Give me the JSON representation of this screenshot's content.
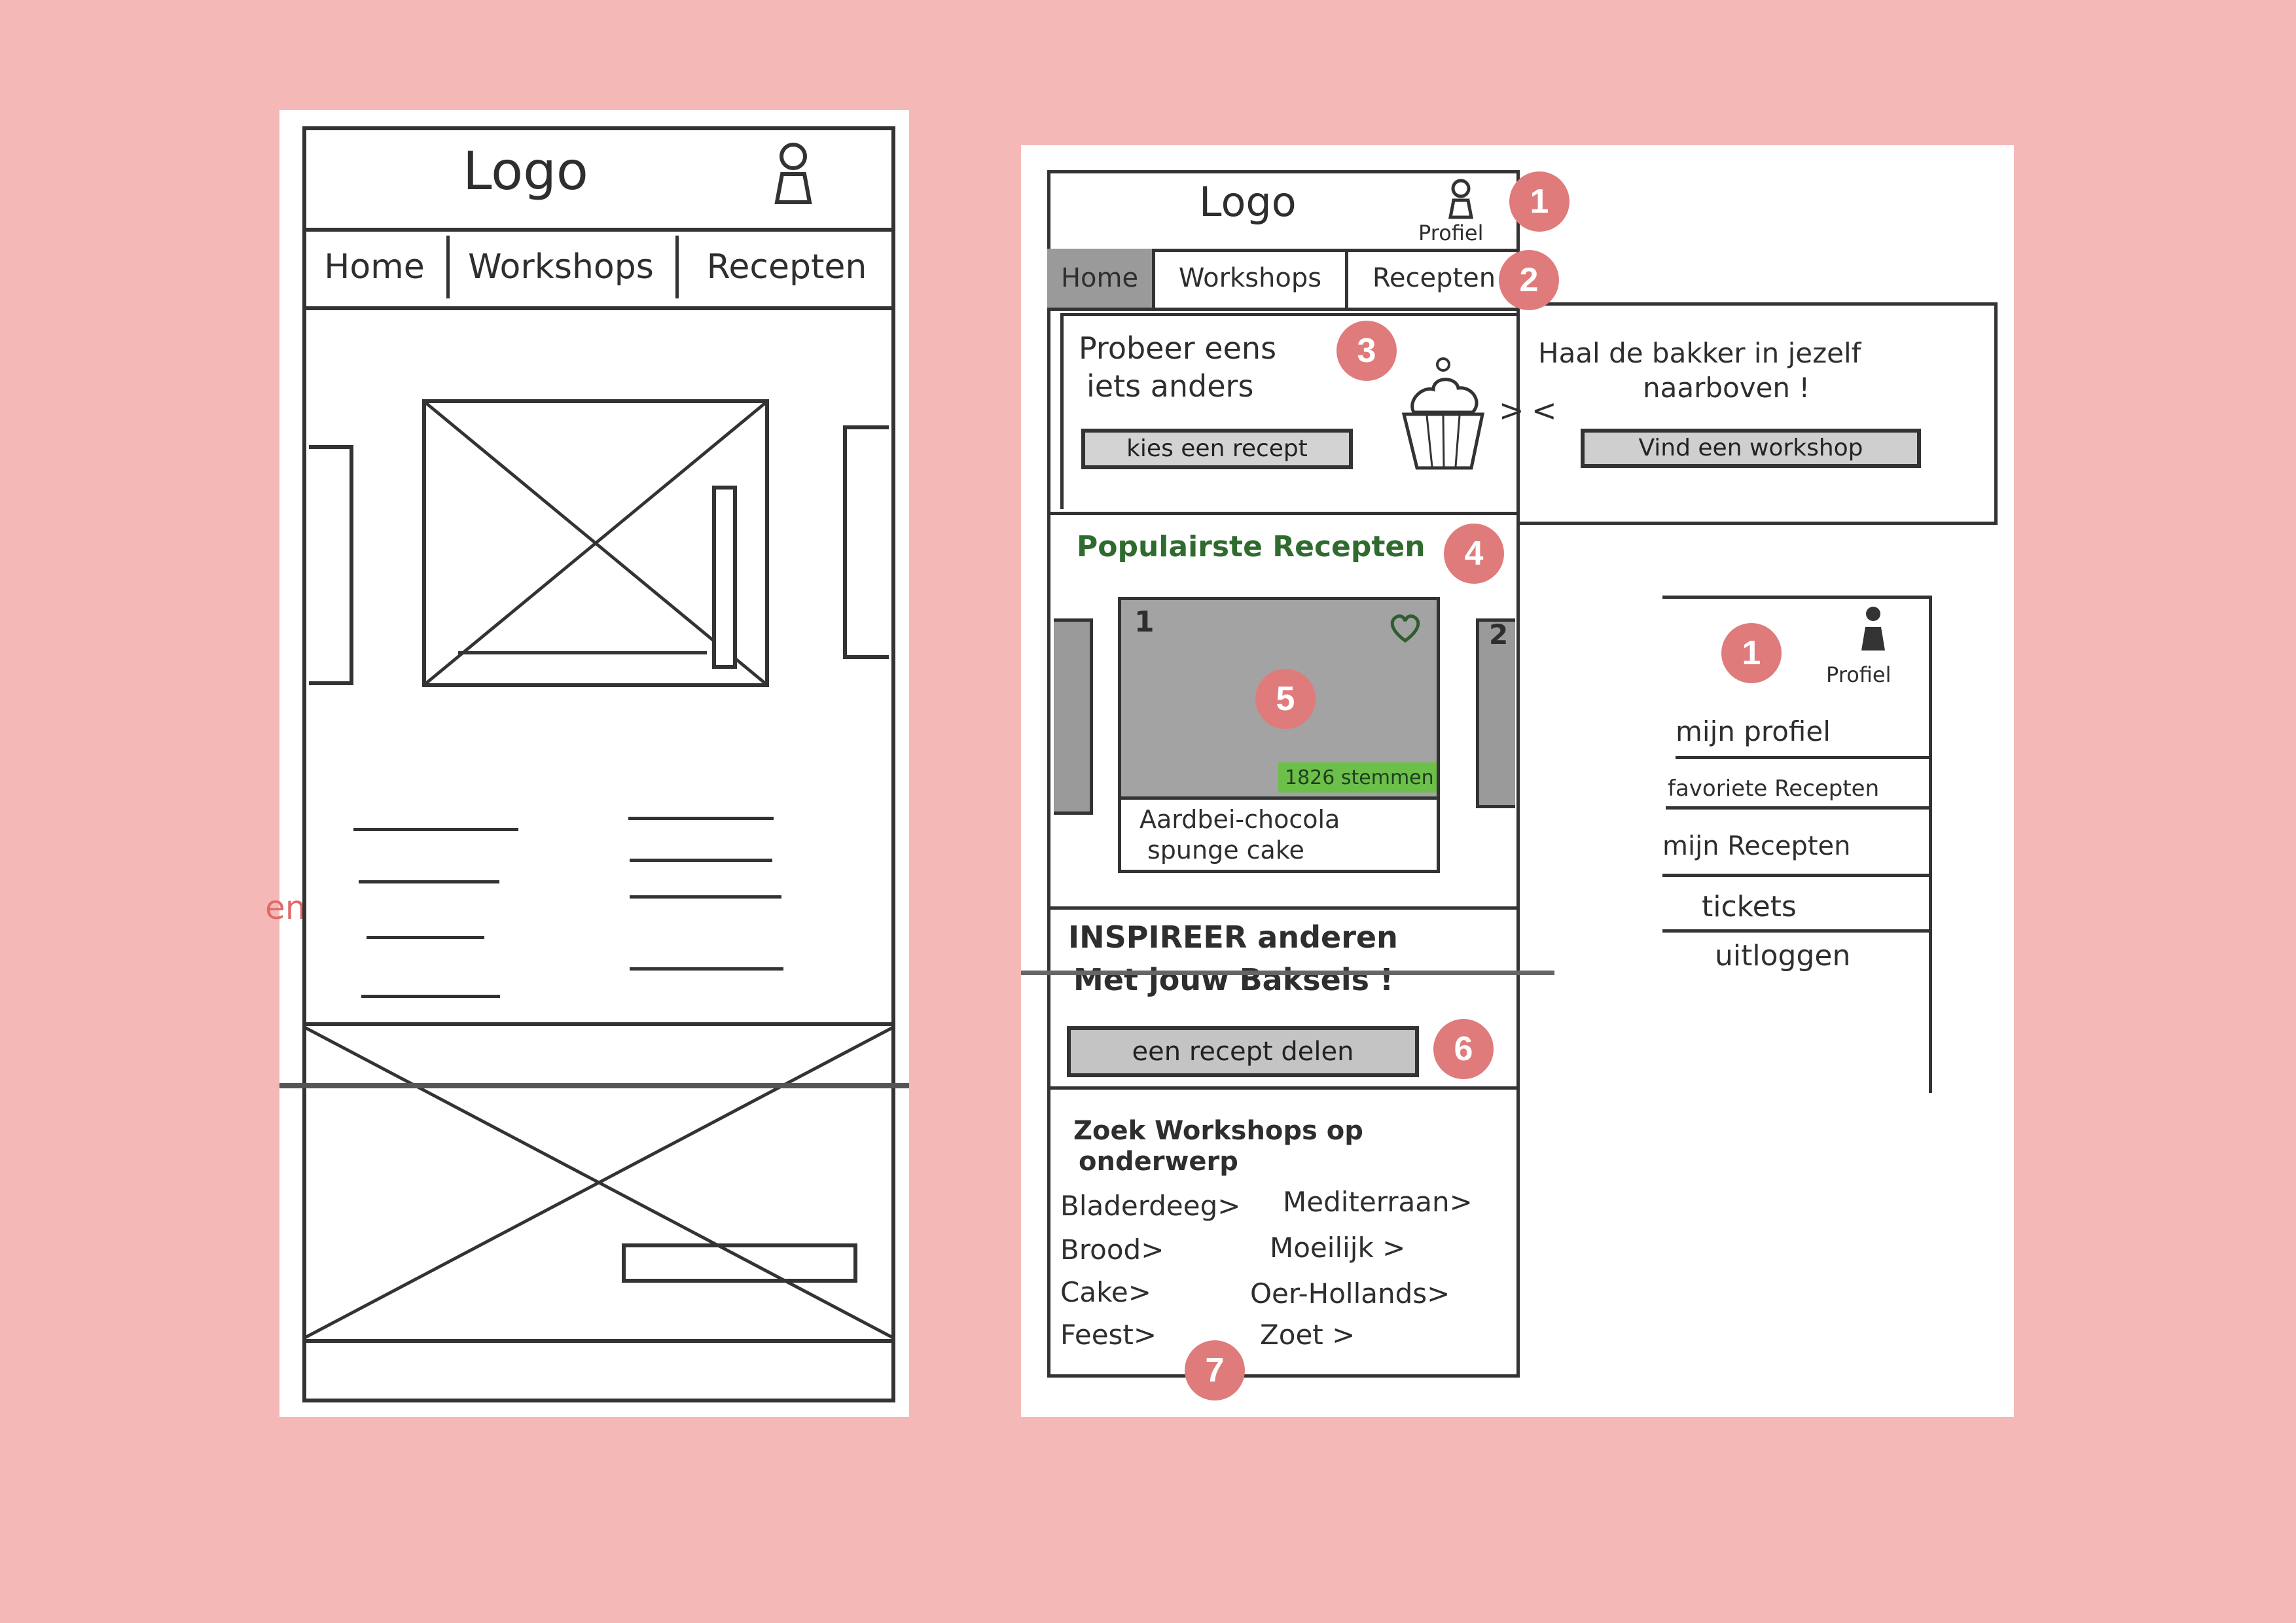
{
  "left_sketch": {
    "logo": "Logo",
    "nav": [
      "Home",
      "Workshops",
      "Recepten"
    ],
    "edge_fragment": "en"
  },
  "right_sketch": {
    "header": {
      "logo": "Logo",
      "profile_label": "Profiel"
    },
    "nav": [
      "Home",
      "Workshops",
      "Recepten"
    ],
    "hero": {
      "slide1_title_line1": "Probeer eens",
      "slide1_title_line2": "iets anders",
      "slide1_button": "kies een recept",
      "slide2_title_line1": "Haal de bakker in jezelf",
      "slide2_title_line2": "naarboven !",
      "slide2_button": "Vind een workshop",
      "arrow_left": "<",
      "arrow_right": ">"
    },
    "popular": {
      "heading": "Populairste Recepten",
      "card_number": "1",
      "next_card_number": "2",
      "votes": "1826 stemmen",
      "card_title_line1": "Aardbei-chocola",
      "card_title_line2": "spunge cake"
    },
    "inspire": {
      "line1": "INSPIREER anderen",
      "line2": "Met jouw Baksels !",
      "button": "een recept delen"
    },
    "workshops": {
      "heading_line1": "Zoek Workshops op",
      "heading_line2": "onderwerp",
      "topics": [
        "Bladerdeeg>",
        "Mediterraan>",
        "Brood>",
        "Moeilijk >",
        "Cake>",
        "Oer-Hollands>",
        "Feest>",
        "Zoet >"
      ]
    },
    "profile_menu": {
      "profile_label": "Profiel",
      "items": [
        "mijn profiel",
        "favoriete Recepten",
        "mijn Recepten",
        "tickets",
        "uitloggen"
      ]
    }
  },
  "badges": [
    "1",
    "2",
    "3",
    "4",
    "5",
    "6",
    "7",
    "1"
  ],
  "colors": {
    "board_background": "#f4b8b6",
    "badge": "#e07b7b",
    "popular_heading": "#2f6b2f",
    "votes_badge": "#6cc04a"
  }
}
